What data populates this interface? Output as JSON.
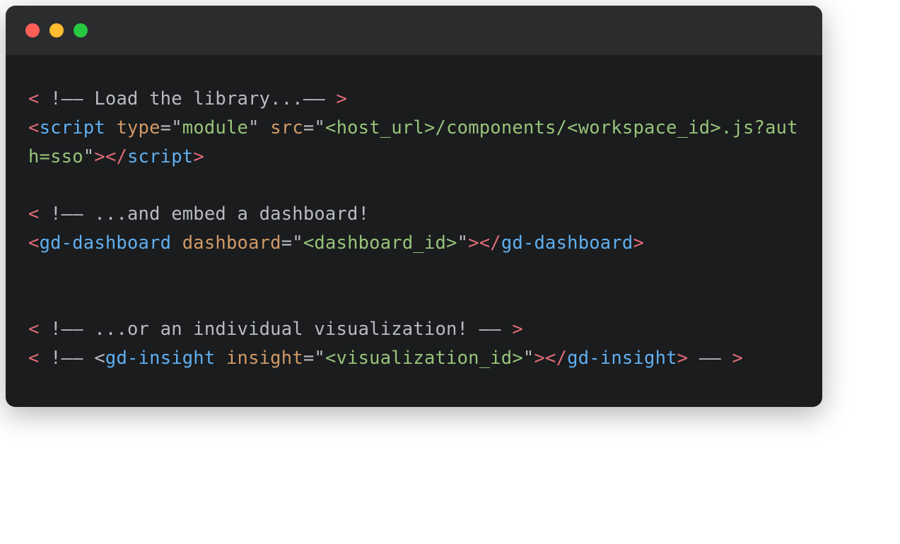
{
  "code": {
    "line1": {
      "open_bracket": "<",
      "bang": " !",
      "comment_start": "––",
      "text": " Load the library...",
      "comment_end": "––",
      "close_bracket": " >"
    },
    "line2": {
      "open_bracket": "<",
      "tag": "script",
      "attr1": " type",
      "eq1": "=",
      "q1a": "\"",
      "val1": "module",
      "q1b": "\"",
      "attr2": " src",
      "eq2": "=",
      "q2a": "\"",
      "val2": "<host_url>/components/",
      "line3_val": "<workspace_id>.js?auth=sso",
      "q2b": "\"",
      "open_close": ">",
      "close_bracket": "</",
      "close_tag": "script",
      "final_bracket": ">"
    },
    "line5": {
      "open_bracket": "<",
      "bang": " !",
      "comment_start": "––",
      "text": " ...and embed a dashboard!"
    },
    "line6": {
      "open_bracket": "<",
      "tag": "gd-dashboard",
      "attr1": " dashboard",
      "eq1": "=",
      "q1a": "\"",
      "val1": "<dashboard_id>",
      "q1b": "\"",
      "open_close": ">",
      "close_bracket": "</",
      "close_tag": "gd-dashboard",
      "final_bracket": ">"
    },
    "line9": {
      "open_bracket": "<",
      "bang": " !",
      "comment_start": "––",
      "text": " ...or an individual visualization! ",
      "comment_end": "––",
      "close_bracket": " >"
    },
    "line10": {
      "open_bracket": "<",
      "bang": " !",
      "comment_start": "––",
      "inner_open": " <",
      "tag": "gd-insight",
      "attr1": " insight",
      "eq1": "=",
      "q1a": "\"",
      "val1": "<visualization_id>",
      "q1b": "\"",
      "inner_close": ">",
      "close_bracket": "</",
      "close_tag": "gd-",
      "line11_close_tag": "insight",
      "line11_final": ">",
      "comment_end": " ––",
      "final_close": " >"
    }
  }
}
